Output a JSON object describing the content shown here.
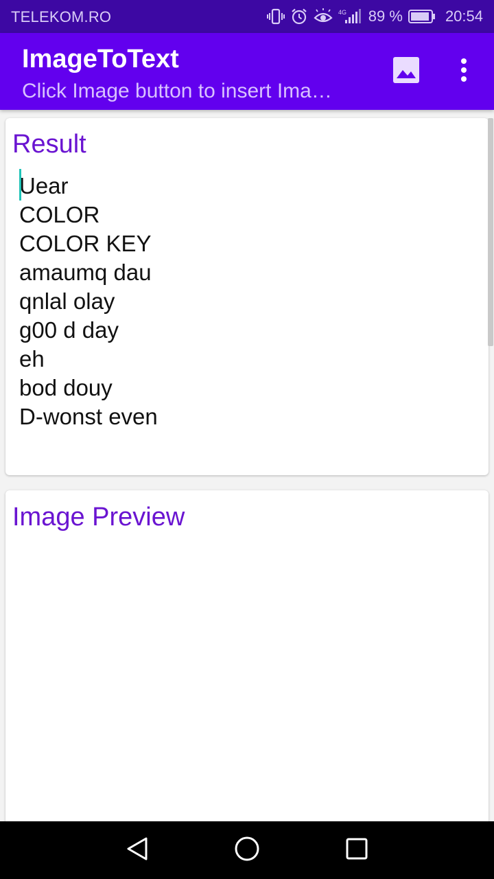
{
  "status_bar": {
    "carrier": "TELEKOM.RO",
    "network_type": "4G",
    "battery_percent": "89 %",
    "time": "20:54",
    "icons": [
      "vibrate-icon",
      "alarm-icon",
      "eye-comfort-icon",
      "signal-icon",
      "battery-icon"
    ]
  },
  "app_bar": {
    "title": "ImageToText",
    "subtitle": "Click Image button  to insert Ima…",
    "actions": [
      "image-icon",
      "more-vert-icon"
    ]
  },
  "result": {
    "title": "Result",
    "lines": [
      "Uear",
      "COLOR",
      "COLOR KEY",
      "amaumq dau",
      "qnlal olay",
      "g00 d day",
      "eh",
      "bod douy",
      "D-wonst even"
    ]
  },
  "preview": {
    "title": "Image Preview"
  },
  "nav_bar": {
    "buttons": [
      "back-icon",
      "home-icon",
      "recents-icon"
    ]
  },
  "colors": {
    "status_bar": "#3d08a3",
    "app_bar": "#6200ee",
    "accent_text": "#6a14d1",
    "cursor": "#20c3b7"
  }
}
